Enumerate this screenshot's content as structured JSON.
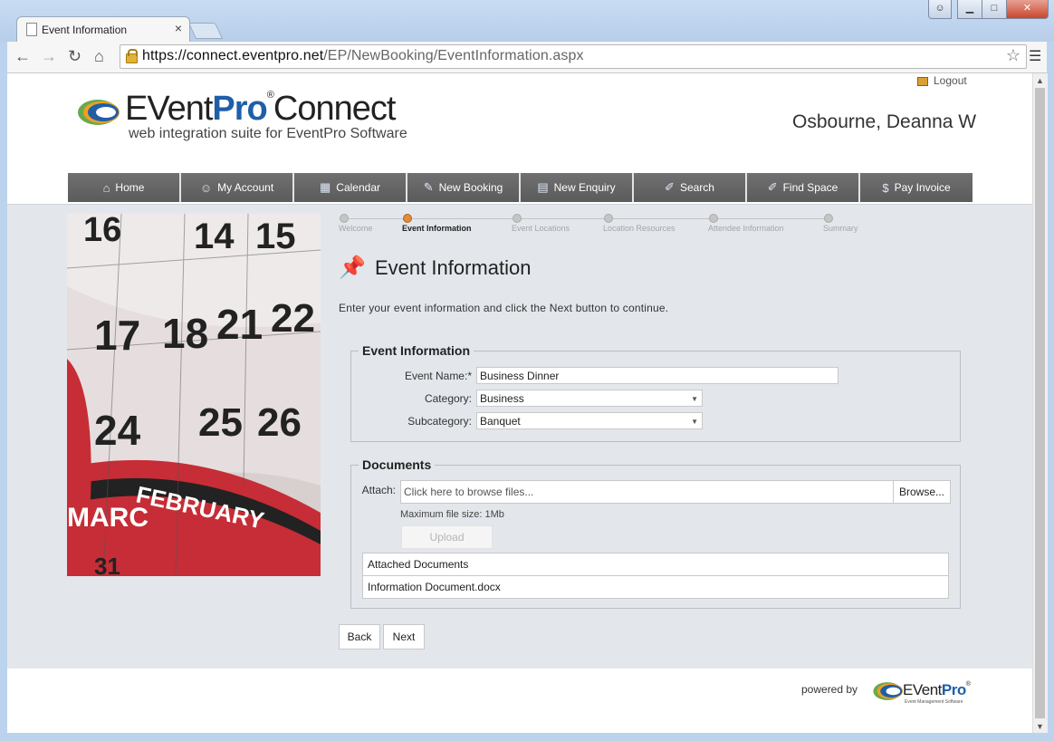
{
  "browser": {
    "tab_title": "Event Information",
    "tab_close": "×",
    "url_host": "https://connect.eventpro.net",
    "url_path": "/EP/NewBooking/EventInformation.aspx"
  },
  "header": {
    "logo_event": "EVent",
    "logo_pro": "Pro",
    "logo_reg": "®",
    "logo_connect": "Connect",
    "tagline": "web integration suite for EventPro Software",
    "logout": "Logout",
    "user_name": "Osbourne, Deanna W"
  },
  "nav": [
    {
      "label": "Home",
      "icon": "home-icon",
      "glyph": "⌂"
    },
    {
      "label": "My Account",
      "icon": "account-icon",
      "glyph": "☺"
    },
    {
      "label": "Calendar",
      "icon": "calendar-icon",
      "glyph": "▦"
    },
    {
      "label": "New Booking",
      "icon": "pushpin-icon",
      "glyph": "✎"
    },
    {
      "label": "New Enquiry",
      "icon": "form-icon",
      "glyph": "▤"
    },
    {
      "label": "Search",
      "icon": "search-icon",
      "glyph": "✐"
    },
    {
      "label": "Find Space",
      "icon": "find-space-icon",
      "glyph": "✐"
    },
    {
      "label": "Pay Invoice",
      "icon": "invoice-icon",
      "glyph": "$"
    }
  ],
  "steps": [
    {
      "label": "Welcome",
      "active": false
    },
    {
      "label": "Event Information",
      "active": true
    },
    {
      "label": "Event Locations",
      "active": false
    },
    {
      "label": "Location Resources",
      "active": false
    },
    {
      "label": "Attendee Information",
      "active": false
    },
    {
      "label": "Summary",
      "active": false
    }
  ],
  "page": {
    "title": "Event Information",
    "intro": "Enter your event information and click the Next button to continue."
  },
  "event_info": {
    "legend": "Event Information",
    "event_name_label": "Event Name:*",
    "event_name_value": "Business Dinner",
    "category_label": "Category:",
    "category_value": "Business",
    "subcategory_label": "Subcategory:",
    "subcategory_value": "Banquet"
  },
  "documents": {
    "legend": "Documents",
    "attach_label": "Attach:",
    "attach_placeholder": "Click here to browse files...",
    "browse": "Browse...",
    "max_size": "Maximum file size: 1Mb",
    "upload": "Upload",
    "table_header": "Attached Documents",
    "files": [
      "Information Document.docx"
    ]
  },
  "actions": {
    "back": "Back",
    "next": "Next"
  },
  "footer": {
    "powered_by": "powered by",
    "logo_event": "EVent",
    "logo_pro": "Pro",
    "logo_reg": "®",
    "logo_sub": "Event Management Software"
  },
  "calendar_image": {
    "dates_row1": [
      "16",
      "14",
      "15"
    ],
    "dates_row2": [
      "17",
      "18",
      "21",
      "22"
    ],
    "dates_row3": [
      "24",
      "25",
      "26"
    ],
    "month1": "MARC",
    "month2": "FEBRUARY",
    "date_bottom": "31"
  },
  "colors": {
    "nav_bg": "#5b5b5b",
    "content_bg": "#e3e7ec",
    "brand_blue": "#1f5fa8",
    "active_step": "#e08a3c",
    "pin_red": "#c0202a"
  }
}
